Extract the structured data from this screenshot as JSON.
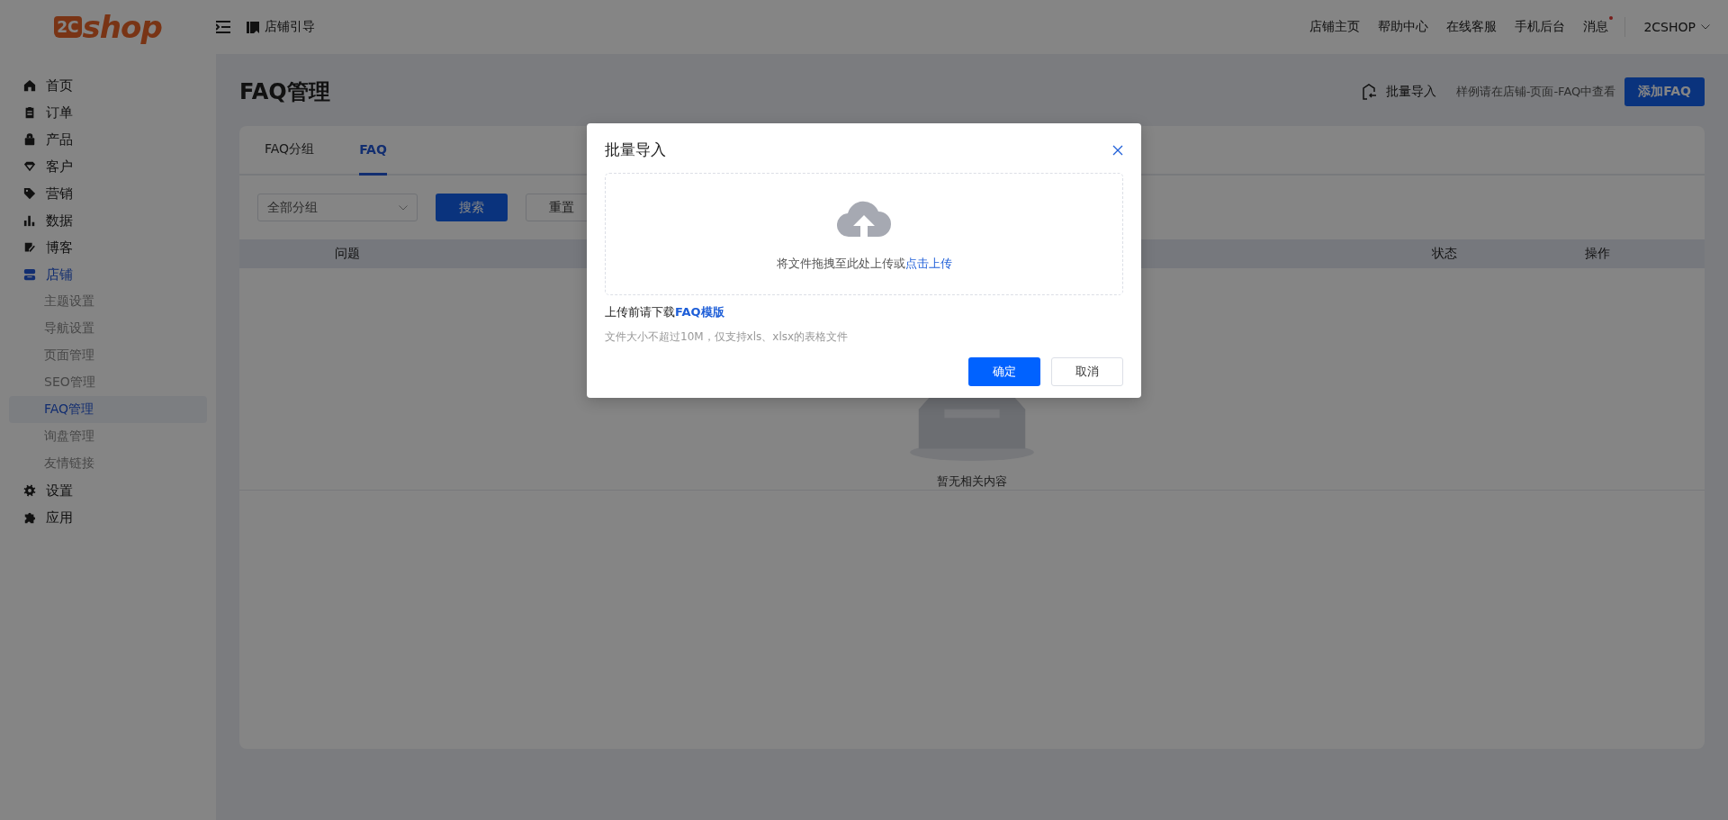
{
  "header": {
    "logo": {
      "badge": "2C",
      "text": "shop"
    },
    "guide": "店铺引导",
    "links": [
      {
        "label": "店铺主页",
        "unread": false
      },
      {
        "label": "帮助中心",
        "unread": false
      },
      {
        "label": "在线客服",
        "unread": false
      },
      {
        "label": "手机后台",
        "unread": false
      },
      {
        "label": "消息",
        "unread": true
      }
    ],
    "user": "2CSHOP"
  },
  "sidebar": {
    "items": [
      {
        "label": "首页",
        "selected": false
      },
      {
        "label": "订单",
        "selected": false
      },
      {
        "label": "产品",
        "selected": false
      },
      {
        "label": "客户",
        "selected": false
      },
      {
        "label": "营销",
        "selected": false
      },
      {
        "label": "数据",
        "selected": false
      },
      {
        "label": "博客",
        "selected": false
      },
      {
        "label": "店铺",
        "selected": true,
        "children": [
          {
            "label": "主题设置",
            "selected": false
          },
          {
            "label": "导航设置",
            "selected": false
          },
          {
            "label": "页面管理",
            "selected": false
          },
          {
            "label": "SEO管理",
            "selected": false
          },
          {
            "label": "FAQ管理",
            "selected": true
          },
          {
            "label": "询盘管理",
            "selected": false
          },
          {
            "label": "友情链接",
            "selected": false
          }
        ]
      },
      {
        "label": "设置",
        "selected": false
      },
      {
        "label": "应用",
        "selected": false
      }
    ]
  },
  "page": {
    "title": "FAQ管理",
    "import": "批量导入",
    "hint": "样例请在店铺-页面-FAQ中查看",
    "add": "添加FAQ"
  },
  "tabs": [
    {
      "label": "FAQ分组",
      "selected": false
    },
    {
      "label": "FAQ",
      "selected": true
    }
  ],
  "filter": {
    "group": "全部分组",
    "search": "搜索",
    "reset": "重置"
  },
  "table": {
    "columns": [
      "问题",
      "状态",
      "操作"
    ],
    "empty": "暂无相关内容"
  },
  "modal": {
    "title": "批量导入",
    "drop_text": "将文件拖拽至此处上传或",
    "drop_link": "点击上传",
    "template_text": "上传前请下载",
    "template_link": "FAQ模版",
    "note": "文件大小不超过10M，仅支持xls、xlsx的表格文件",
    "confirm": "确定",
    "cancel": "取消"
  }
}
